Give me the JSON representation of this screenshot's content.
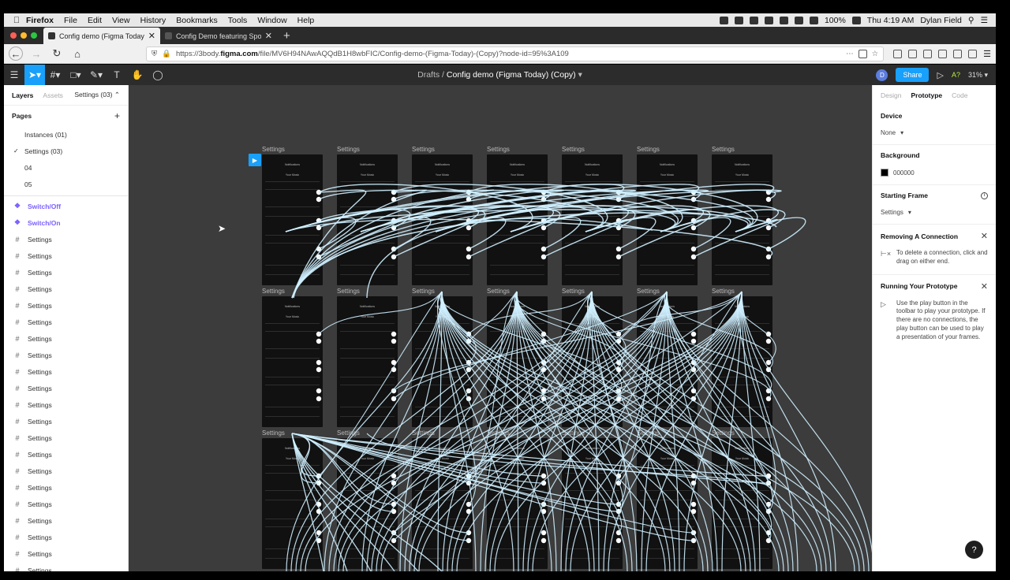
{
  "menubar": {
    "apple": "",
    "items": [
      "Firefox",
      "File",
      "Edit",
      "View",
      "History",
      "Bookmarks",
      "Tools",
      "Window",
      "Help"
    ],
    "battery": "100%",
    "clock": "Thu 4:19 AM",
    "user": "Dylan Field"
  },
  "tabs": [
    {
      "title": "Config demo (Figma Today) (Cc",
      "active": true
    },
    {
      "title": "Config Demo featuring Spotify",
      "active": false
    }
  ],
  "nav": {
    "url_prefix": "https://3body.",
    "url_domain": "figma.com",
    "url_rest": "/file/MV6H94NAwAQQdB1H8wbFIC/Config-demo-(Figma-Today)-(Copy)?node-id=95%3A109"
  },
  "toolbar": {
    "breadcrumb": "Drafts",
    "separator": "/",
    "file_title": "Config demo (Figma Today) (Copy)",
    "avatar": "D",
    "share": "Share",
    "a_label": "A?",
    "zoom": "31%"
  },
  "left": {
    "tabs": {
      "layers": "Layers",
      "assets": "Assets",
      "page": "Settings (03)"
    },
    "pages_title": "Pages",
    "pages": [
      {
        "label": "Instances (01)",
        "selected": false
      },
      {
        "label": "Settings (03)",
        "selected": true
      },
      {
        "label": "04",
        "selected": false
      },
      {
        "label": "05",
        "selected": false
      }
    ],
    "components": [
      "Switch/Off",
      "Switch/On"
    ],
    "frames": [
      "Settings",
      "Settings",
      "Settings",
      "Settings",
      "Settings",
      "Settings",
      "Settings",
      "Settings",
      "Settings",
      "Settings",
      "Settings",
      "Settings",
      "Settings",
      "Settings",
      "Settings",
      "Settings",
      "Settings",
      "Settings",
      "Settings",
      "Settings",
      "Settings",
      "Settings"
    ]
  },
  "canvas": {
    "frame_label": "Settings",
    "frame_title": "Notifications",
    "frame_subtitle": "Your Music",
    "rows": 3,
    "cols": 7
  },
  "right": {
    "tabs": {
      "design": "Design",
      "prototype": "Prototype",
      "code": "Code"
    },
    "device_title": "Device",
    "device_value": "None",
    "background_title": "Background",
    "background_value": "000000",
    "starting_title": "Starting Frame",
    "starting_value": "Settings",
    "removing_title": "Removing A Connection",
    "removing_text": "To delete a connection, click and drag on either end.",
    "running_title": "Running Your Prototype",
    "running_text": "Use the play button in the toolbar to play your prototype. If there are no connections, the play button can be used to play a presentation of your frames.",
    "help": "?"
  },
  "colors": {
    "accent": "#18a0fb",
    "component": "#7b61ff",
    "canvas_bg": "#3c3c3c",
    "connector": "#cfefff"
  }
}
